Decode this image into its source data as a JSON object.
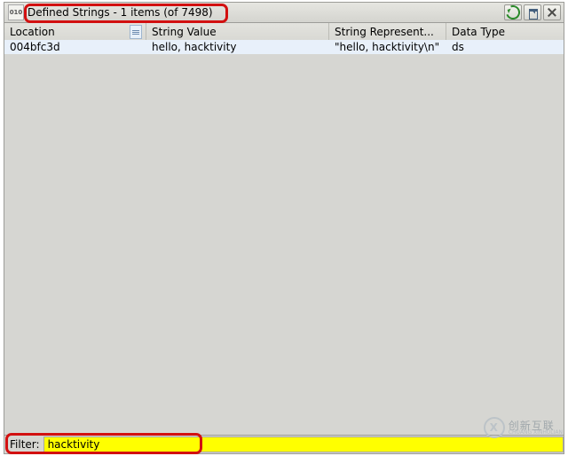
{
  "title": "Defined Strings - 1 items (of 7498)",
  "columns": {
    "location": "Location",
    "string_value": "String Value",
    "string_repr": "String Represent...",
    "data_type": "Data Type"
  },
  "rows": [
    {
      "location": "004bfc3d",
      "string_value": "hello, hacktivity",
      "string_repr": "\"hello, hacktivity\\n\"",
      "data_type": "ds"
    }
  ],
  "filter": {
    "label": "Filter:",
    "value": "hacktivity"
  },
  "watermark": {
    "main": "创新互联",
    "sub": "CHUANG XINHULIAN"
  }
}
